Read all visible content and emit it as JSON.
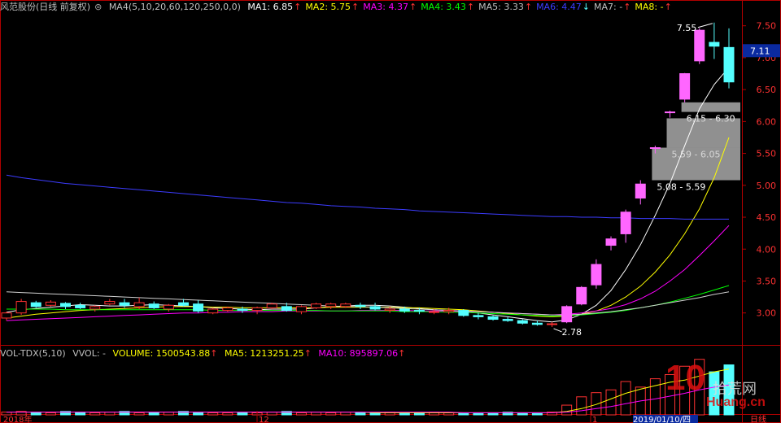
{
  "header": {
    "title": "风范股份(日线 前复权)",
    "ma_label": "MA4(5,10,20,60,120,250,0,0)",
    "ma_items": [
      {
        "label": "MA1: 6.85",
        "color": "#ffffff"
      },
      {
        "label": "MA2: 5.75",
        "color": "#ffff00"
      },
      {
        "label": "MA3: 4.37",
        "color": "#ff00ff"
      },
      {
        "label": "MA4: 3.43",
        "color": "#00ff00"
      },
      {
        "label": "MA5: 3.33",
        "color": "#c0c0c0"
      },
      {
        "label": "MA6: 4.47",
        "color": "#3c3cff"
      },
      {
        "label": "MA7: -",
        "color": "#c0c0c0"
      },
      {
        "label": "MA8: -",
        "color": "#ffff00"
      }
    ]
  },
  "volume_header": {
    "label": "VOL-TDX(5,10)",
    "vvol": "VVOL: -",
    "volume": "VOLUME: 1500543.88",
    "ma5": "MA5: 1213251.25",
    "ma10": "MA10: 895897.06"
  },
  "colors": {
    "up": "#ff3232",
    "up_fill": "#ff66ff",
    "down": "#54ffff",
    "axis": "#b00000"
  },
  "chart_data": {
    "type": "candlestick",
    "y_axis": {
      "ticks": [
        "7.50",
        "7.00",
        "6.50",
        "6.00",
        "5.50",
        "5.00",
        "4.50",
        "4.00",
        "3.50",
        "3.00"
      ],
      "ylim": [
        2.55,
        7.7
      ]
    },
    "x_axis": {
      "labels": [
        "2018年",
        "12",
        "1",
        "2019/01/10/四",
        "日线"
      ]
    },
    "last_price": "7.11",
    "annotations": {
      "high": "7.55",
      "low": "2.78",
      "gaps": [
        "6.15 - 6.30",
        "5.59 - 6.05",
        "5.08 - 5.59"
      ]
    },
    "ohlc": [
      [
        2.92,
        3.02,
        2.88,
        3.0
      ],
      [
        3.0,
        3.22,
        2.97,
        3.18
      ],
      [
        3.16,
        3.19,
        3.08,
        3.1
      ],
      [
        3.12,
        3.2,
        3.1,
        3.17
      ],
      [
        3.15,
        3.17,
        3.06,
        3.1
      ],
      [
        3.12,
        3.16,
        3.06,
        3.08
      ],
      [
        3.06,
        3.12,
        3.02,
        3.1
      ],
      [
        3.14,
        3.22,
        3.12,
        3.18
      ],
      [
        3.16,
        3.22,
        3.08,
        3.12
      ],
      [
        3.1,
        3.24,
        3.06,
        3.16
      ],
      [
        3.14,
        3.18,
        3.06,
        3.08
      ],
      [
        3.06,
        3.14,
        3.02,
        3.12
      ],
      [
        3.16,
        3.22,
        3.1,
        3.12
      ],
      [
        3.14,
        3.2,
        3.0,
        3.03
      ],
      [
        3.0,
        3.08,
        2.98,
        3.06
      ],
      [
        3.04,
        3.1,
        3.02,
        3.08
      ],
      [
        3.06,
        3.1,
        3.0,
        3.04
      ],
      [
        3.04,
        3.1,
        2.98,
        3.08
      ],
      [
        3.08,
        3.16,
        3.06,
        3.14
      ],
      [
        3.1,
        3.16,
        3.02,
        3.04
      ],
      [
        3.02,
        3.12,
        2.98,
        3.1
      ],
      [
        3.08,
        3.16,
        3.06,
        3.14
      ],
      [
        3.1,
        3.16,
        3.06,
        3.14
      ],
      [
        3.1,
        3.16,
        3.08,
        3.14
      ],
      [
        3.12,
        3.16,
        3.06,
        3.1
      ],
      [
        3.1,
        3.16,
        3.04,
        3.06
      ],
      [
        3.04,
        3.1,
        3.0,
        3.06
      ],
      [
        3.06,
        3.1,
        3.0,
        3.03
      ],
      [
        3.04,
        3.08,
        2.98,
        3.03
      ],
      [
        3.02,
        3.06,
        2.98,
        3.02
      ],
      [
        3.02,
        3.08,
        2.98,
        3.04
      ],
      [
        3.04,
        3.06,
        2.94,
        2.96
      ],
      [
        2.96,
        3.0,
        2.9,
        2.94
      ],
      [
        2.94,
        2.96,
        2.88,
        2.9
      ],
      [
        2.9,
        2.94,
        2.86,
        2.88
      ],
      [
        2.88,
        2.9,
        2.82,
        2.84
      ],
      [
        2.84,
        2.88,
        2.8,
        2.82
      ],
      [
        2.82,
        2.86,
        2.78,
        2.83
      ],
      [
        2.86,
        3.12,
        2.84,
        3.1
      ],
      [
        3.14,
        3.42,
        3.12,
        3.4
      ],
      [
        3.44,
        3.84,
        3.38,
        3.76
      ],
      [
        4.06,
        4.2,
        3.98,
        4.16
      ],
      [
        4.24,
        4.62,
        4.1,
        4.58
      ],
      [
        4.8,
        5.08,
        4.7,
        5.02
      ],
      [
        5.59,
        5.62,
        5.5,
        5.59
      ],
      [
        6.14,
        6.17,
        6.06,
        6.15
      ],
      [
        6.35,
        6.76,
        6.3,
        6.75
      ],
      [
        6.95,
        7.46,
        6.9,
        7.43
      ],
      [
        7.24,
        7.55,
        6.98,
        7.18
      ],
      [
        7.16,
        7.46,
        6.52,
        6.62
      ]
    ],
    "series": [
      {
        "name": "MA1",
        "values": [
          3.01,
          3.05,
          3.07,
          3.09,
          3.11,
          3.13,
          3.12,
          3.11,
          3.11,
          3.12,
          3.13,
          3.12,
          3.11,
          3.1,
          3.08,
          3.07,
          3.06,
          3.05,
          3.06,
          3.06,
          3.06,
          3.08,
          3.1,
          3.11,
          3.12,
          3.12,
          3.11,
          3.09,
          3.07,
          3.05,
          3.04,
          3.02,
          3.0,
          2.97,
          2.94,
          2.91,
          2.88,
          2.86,
          2.89,
          2.98,
          3.12,
          3.35,
          3.68,
          4.07,
          4.53,
          5.03,
          5.62,
          6.2,
          6.58,
          6.85
        ]
      },
      {
        "name": "MA2",
        "values": [
          2.92,
          2.95,
          2.98,
          3.0,
          3.02,
          3.04,
          3.05,
          3.06,
          3.07,
          3.08,
          3.09,
          3.1,
          3.1,
          3.1,
          3.09,
          3.09,
          3.08,
          3.08,
          3.08,
          3.08,
          3.08,
          3.08,
          3.09,
          3.09,
          3.09,
          3.09,
          3.09,
          3.08,
          3.08,
          3.07,
          3.06,
          3.05,
          3.03,
          3.01,
          2.99,
          2.97,
          2.95,
          2.94,
          2.95,
          2.98,
          3.03,
          3.12,
          3.25,
          3.42,
          3.64,
          3.91,
          4.24,
          4.63,
          5.12,
          5.75
        ]
      },
      {
        "name": "MA3",
        "values": [
          2.88,
          2.89,
          2.9,
          2.91,
          2.92,
          2.93,
          2.94,
          2.95,
          2.96,
          2.97,
          2.98,
          2.99,
          3.0,
          3.0,
          3.01,
          3.01,
          3.02,
          3.02,
          3.02,
          3.03,
          3.03,
          3.03,
          3.03,
          3.03,
          3.04,
          3.04,
          3.04,
          3.04,
          3.03,
          3.03,
          3.03,
          3.02,
          3.02,
          3.01,
          3.0,
          2.99,
          2.98,
          2.97,
          2.98,
          3.0,
          3.03,
          3.07,
          3.13,
          3.22,
          3.34,
          3.5,
          3.68,
          3.9,
          4.13,
          4.37
        ]
      },
      {
        "name": "MA4",
        "values": [
          3.06,
          3.06,
          3.06,
          3.06,
          3.05,
          3.05,
          3.05,
          3.05,
          3.05,
          3.05,
          3.05,
          3.05,
          3.05,
          3.05,
          3.04,
          3.04,
          3.04,
          3.04,
          3.04,
          3.04,
          3.04,
          3.04,
          3.03,
          3.03,
          3.03,
          3.03,
          3.03,
          3.02,
          3.02,
          3.02,
          3.01,
          3.01,
          3.0,
          2.99,
          2.98,
          2.97,
          2.96,
          2.95,
          2.96,
          2.97,
          2.99,
          3.01,
          3.04,
          3.08,
          3.12,
          3.17,
          3.23,
          3.29,
          3.36,
          3.43
        ]
      },
      {
        "name": "MA5",
        "values": [
          3.33,
          3.32,
          3.31,
          3.3,
          3.29,
          3.28,
          3.27,
          3.26,
          3.25,
          3.24,
          3.23,
          3.22,
          3.21,
          3.2,
          3.19,
          3.18,
          3.17,
          3.16,
          3.15,
          3.14,
          3.13,
          3.12,
          3.11,
          3.1,
          3.1,
          3.09,
          3.08,
          3.07,
          3.06,
          3.05,
          3.04,
          3.03,
          3.02,
          3.01,
          3.0,
          2.99,
          2.98,
          2.97,
          2.97,
          2.98,
          3.0,
          3.02,
          3.05,
          3.08,
          3.12,
          3.16,
          3.2,
          3.24,
          3.29,
          3.33
        ]
      },
      {
        "name": "MA6",
        "values": [
          5.16,
          5.12,
          5.09,
          5.06,
          5.03,
          5.01,
          4.99,
          4.97,
          4.95,
          4.93,
          4.91,
          4.89,
          4.87,
          4.85,
          4.83,
          4.81,
          4.79,
          4.77,
          4.75,
          4.73,
          4.72,
          4.7,
          4.68,
          4.67,
          4.66,
          4.64,
          4.63,
          4.62,
          4.6,
          4.59,
          4.58,
          4.57,
          4.56,
          4.55,
          4.54,
          4.53,
          4.52,
          4.51,
          4.51,
          4.5,
          4.5,
          4.49,
          4.49,
          4.48,
          4.48,
          4.48,
          4.47,
          4.47,
          4.47,
          4.47
        ]
      }
    ],
    "volume": {
      "values": [
        4,
        5,
        4,
        3,
        5,
        4,
        3,
        4,
        5,
        3,
        3,
        4,
        5,
        4,
        3,
        3,
        4,
        3,
        4,
        5,
        3,
        4,
        3,
        4,
        3,
        3,
        4,
        3,
        3,
        4,
        3,
        3,
        3,
        3,
        4,
        3,
        3,
        4,
        14,
        26,
        32,
        36,
        48,
        40,
        52,
        58,
        70,
        80,
        62,
        72
      ],
      "ma5": [
        4,
        4,
        4,
        4,
        4,
        4,
        4,
        4,
        4,
        4,
        4,
        4,
        4,
        4,
        4,
        4,
        4,
        4,
        4,
        4,
        4,
        4,
        4,
        4,
        4,
        3,
        3,
        3,
        3,
        3,
        3,
        3,
        3,
        3,
        3,
        3,
        3,
        3,
        5,
        9,
        15,
        23,
        31,
        37,
        42,
        47,
        50,
        56,
        62,
        66
      ],
      "ma10": [
        4,
        4,
        4,
        4,
        4,
        4,
        4,
        4,
        4,
        4,
        4,
        4,
        4,
        4,
        4,
        4,
        4,
        4,
        4,
        4,
        4,
        4,
        4,
        4,
        4,
        4,
        4,
        4,
        4,
        4,
        4,
        3,
        3,
        3,
        3,
        3,
        3,
        3,
        4,
        6,
        9,
        12,
        16,
        20,
        23,
        27,
        31,
        36,
        40,
        43
      ]
    }
  },
  "watermark": {
    "number": "10",
    "text_cn": "拾荒网",
    "text_en": "Huang.cn"
  }
}
